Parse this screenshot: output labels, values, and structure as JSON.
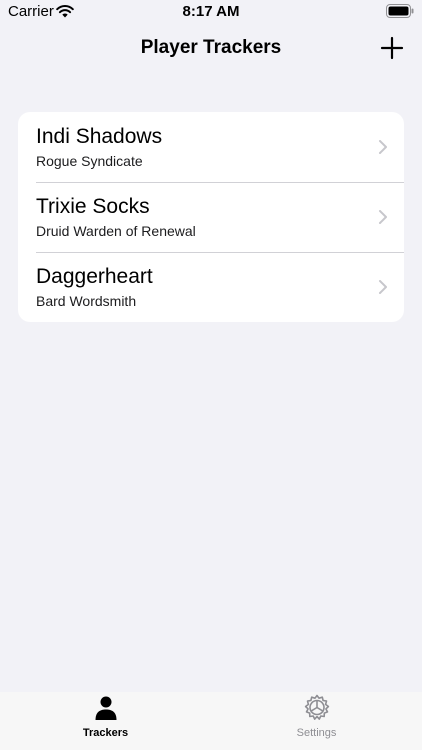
{
  "status_bar": {
    "carrier": "Carrier",
    "time": "8:17 AM"
  },
  "nav": {
    "title": "Player Trackers",
    "add_icon": "plus-icon"
  },
  "trackers": [
    {
      "name": "Indi Shadows",
      "subtitle": "Rogue Syndicate"
    },
    {
      "name": "Trixie Socks",
      "subtitle": "Druid Warden of Renewal"
    },
    {
      "name": "Daggerheart",
      "subtitle": "Bard Wordsmith"
    }
  ],
  "tab_bar": {
    "tabs": [
      {
        "label": "Trackers",
        "icon": "person-icon",
        "selected": true
      },
      {
        "label": "Settings",
        "icon": "gear-icon",
        "selected": false
      }
    ]
  },
  "colors": {
    "background": "#f2f2f7",
    "card": "#ffffff",
    "separator": "#d1d1d6",
    "chevron": "#c7c7cc",
    "tab_inactive": "#8e8e93"
  }
}
